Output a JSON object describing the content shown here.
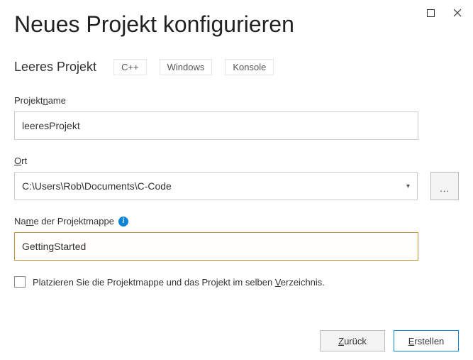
{
  "window": {
    "title": "Neues Projekt konfigurieren"
  },
  "subheader": {
    "project_type": "Leeres Projekt",
    "tags": [
      "C++",
      "Windows",
      "Konsole"
    ]
  },
  "fields": {
    "project_name": {
      "label_pre": "Projekt",
      "label_u": "n",
      "label_post": "ame",
      "value": "leeresProjekt"
    },
    "location": {
      "label_pre": "",
      "label_u": "O",
      "label_post": "rt",
      "value": "C:\\Users\\Rob\\Documents\\C-Code",
      "browse_label": "..."
    },
    "solution_name": {
      "label_pre": "Na",
      "label_u": "m",
      "label_post": "e der Projektmappe",
      "value": "GettingStarted"
    }
  },
  "checkbox": {
    "label_pre": "Platzieren Sie die Projektmappe und das Projekt im selben ",
    "label_u": "V",
    "label_post": "erzeichnis.",
    "checked": false
  },
  "buttons": {
    "back_pre": "",
    "back_u": "Z",
    "back_post": "urück",
    "create_pre": "",
    "create_u": "E",
    "create_post": "rstellen"
  }
}
